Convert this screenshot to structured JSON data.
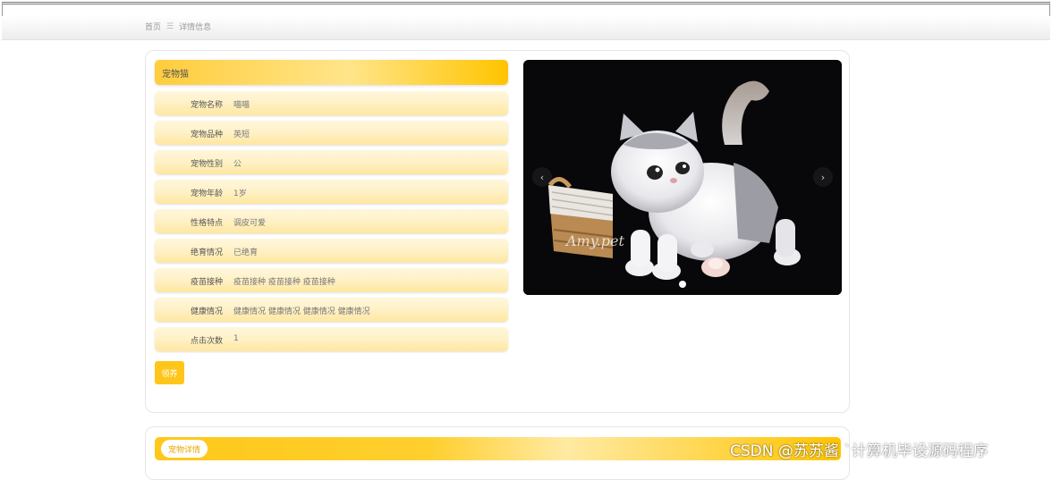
{
  "breadcrumb": {
    "home": "首页",
    "separator": "☰",
    "current": "详情信息"
  },
  "title": "宠物猫",
  "fields": [
    {
      "label": "宠物名称",
      "value": "喵喵"
    },
    {
      "label": "宠物品种",
      "value": "英短"
    },
    {
      "label": "宠物性别",
      "value": "公"
    },
    {
      "label": "宠物年龄",
      "value": "1岁"
    },
    {
      "label": "性格特点",
      "value": "调皮可爱"
    },
    {
      "label": "绝育情况",
      "value": "已绝育"
    },
    {
      "label": "疫苗接种",
      "value": "疫苗接种 疫苗接种 疫苗接种"
    },
    {
      "label": "健康情况",
      "value": "健康情况 健康情况 健康情况 健康情况"
    },
    {
      "label": "点击次数",
      "value": "1"
    }
  ],
  "adopt_button": "领养",
  "carousel": {
    "prev_icon": "chevron-left-icon",
    "next_icon": "chevron-right-icon",
    "image_text": "Amy.pet"
  },
  "detail_tab": "宠物详情",
  "watermark": "CSDN @苏苏酱    `计算机毕设源码程序",
  "colors": {
    "accent": "#ffc61a",
    "row_bg": "#fff1c6"
  }
}
